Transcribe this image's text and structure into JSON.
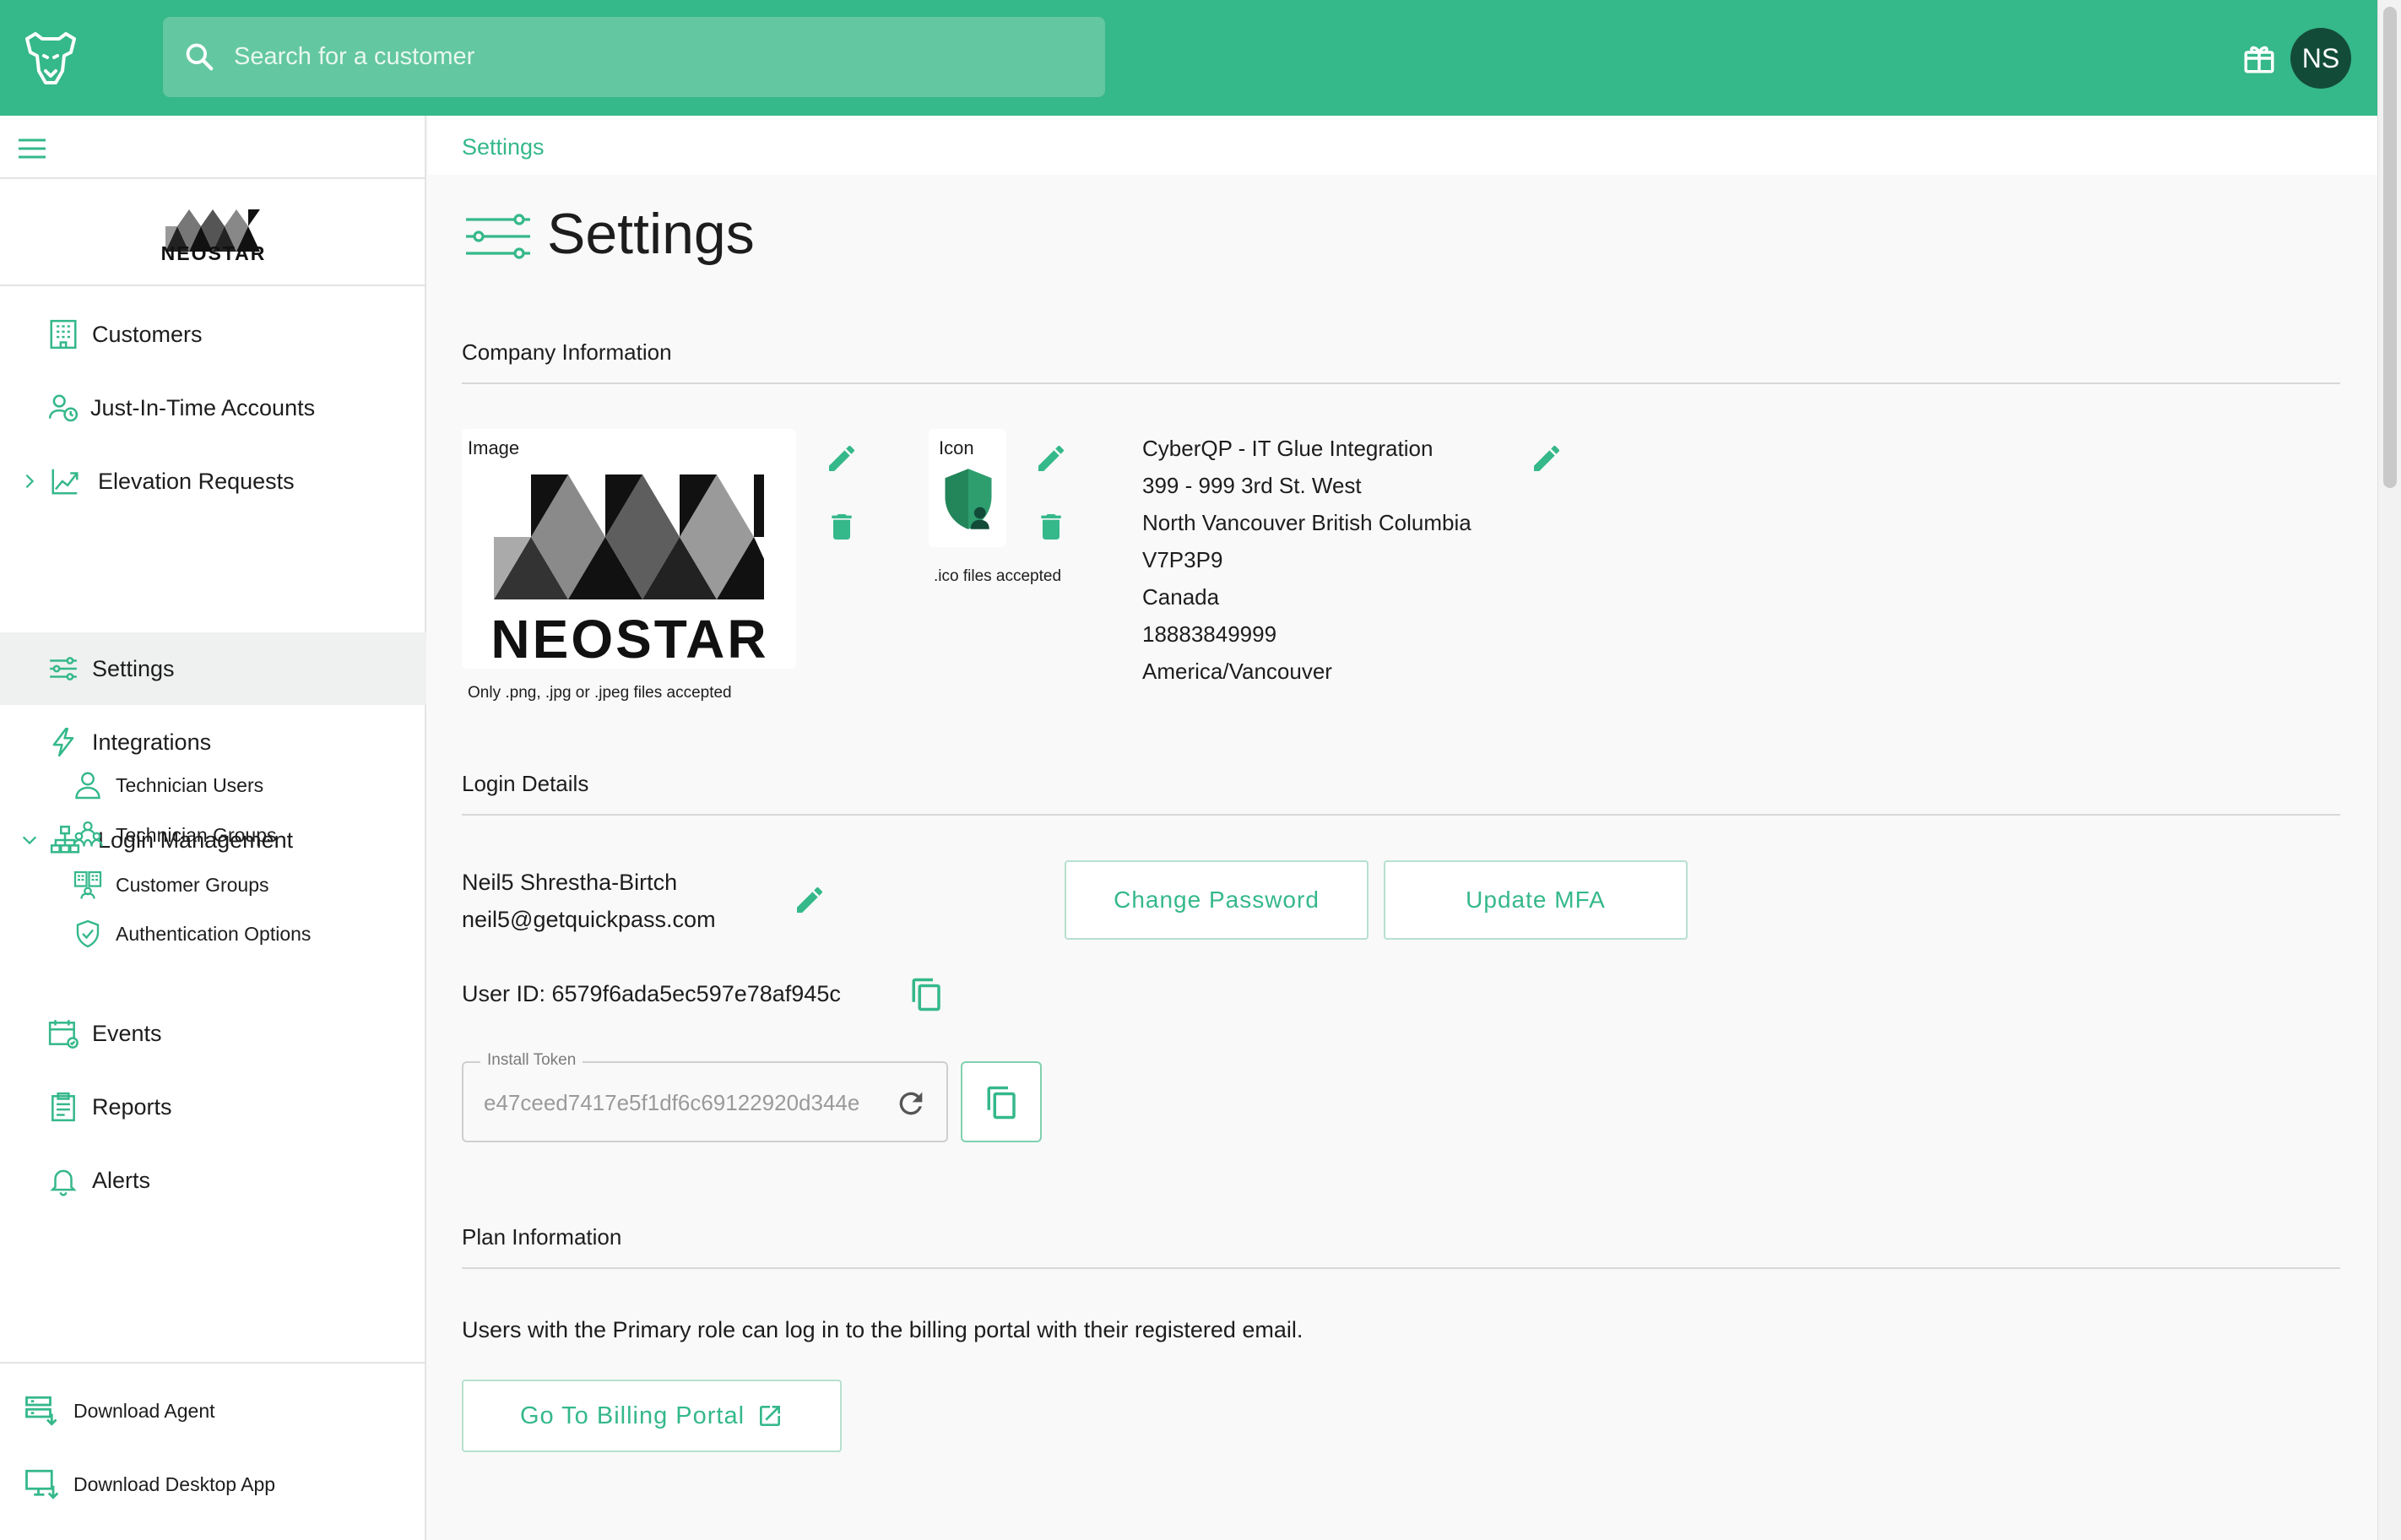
{
  "app": {
    "accent": "#35b88a",
    "avatar_initials": "NS"
  },
  "search": {
    "placeholder": "Search for a customer"
  },
  "brand": {
    "name": "NEOSTAR"
  },
  "sidebar": {
    "items": [
      {
        "label": "Customers",
        "icon": "building-icon"
      },
      {
        "label": "Just-In-Time Accounts",
        "icon": "user-clock-icon"
      },
      {
        "label": "Elevation Requests",
        "icon": "chart-up-icon"
      },
      {
        "label": "Settings",
        "icon": "sliders-icon",
        "active": true
      },
      {
        "label": "Integrations",
        "icon": "lightning-icon"
      },
      {
        "label": "Login Management",
        "icon": "org-chart-icon"
      },
      {
        "label": "Events",
        "icon": "calendar-icon"
      },
      {
        "label": "Reports",
        "icon": "clipboard-icon"
      },
      {
        "label": "Alerts",
        "icon": "bell-icon"
      }
    ],
    "login_management_children": [
      {
        "label": "Technician Users",
        "icon": "person-icon"
      },
      {
        "label": "Technician Groups",
        "icon": "group-icon"
      },
      {
        "label": "Customer Groups",
        "icon": "customer-group-icon"
      },
      {
        "label": "Authentication Options",
        "icon": "shield-check-icon"
      }
    ],
    "bottom": [
      {
        "label": "Download Agent",
        "icon": "server-download-icon"
      },
      {
        "label": "Download Desktop App",
        "icon": "monitor-download-icon"
      }
    ]
  },
  "breadcrumb": "Settings",
  "page": {
    "title": "Settings"
  },
  "company": {
    "heading": "Company Information",
    "image_label": "Image",
    "image_hint": "Only .png, .jpg or .jpeg files accepted",
    "icon_label": "Icon",
    "icon_hint": ".ico files accepted",
    "lines": [
      "CyberQP - IT Glue Integration",
      "399 - 999 3rd St. West",
      "North Vancouver British Columbia",
      "V7P3P9",
      "Canada",
      "18883849999",
      "America/Vancouver"
    ]
  },
  "login": {
    "heading": "Login Details",
    "name": "Neil5 Shrestha-Birtch",
    "email": "neil5@getquickpass.com",
    "change_password": "Change Password",
    "update_mfa": "Update MFA",
    "user_id_line": "User ID: 6579f6ada5ec597e78af945c",
    "token_label": "Install Token",
    "token_value": "e47ceed7417e5f1df6c69122920d344e"
  },
  "plan": {
    "heading": "Plan Information",
    "text": "Users with the Primary role can log in to the billing portal with their registered email.",
    "billing_button": "Go To Billing Portal"
  }
}
